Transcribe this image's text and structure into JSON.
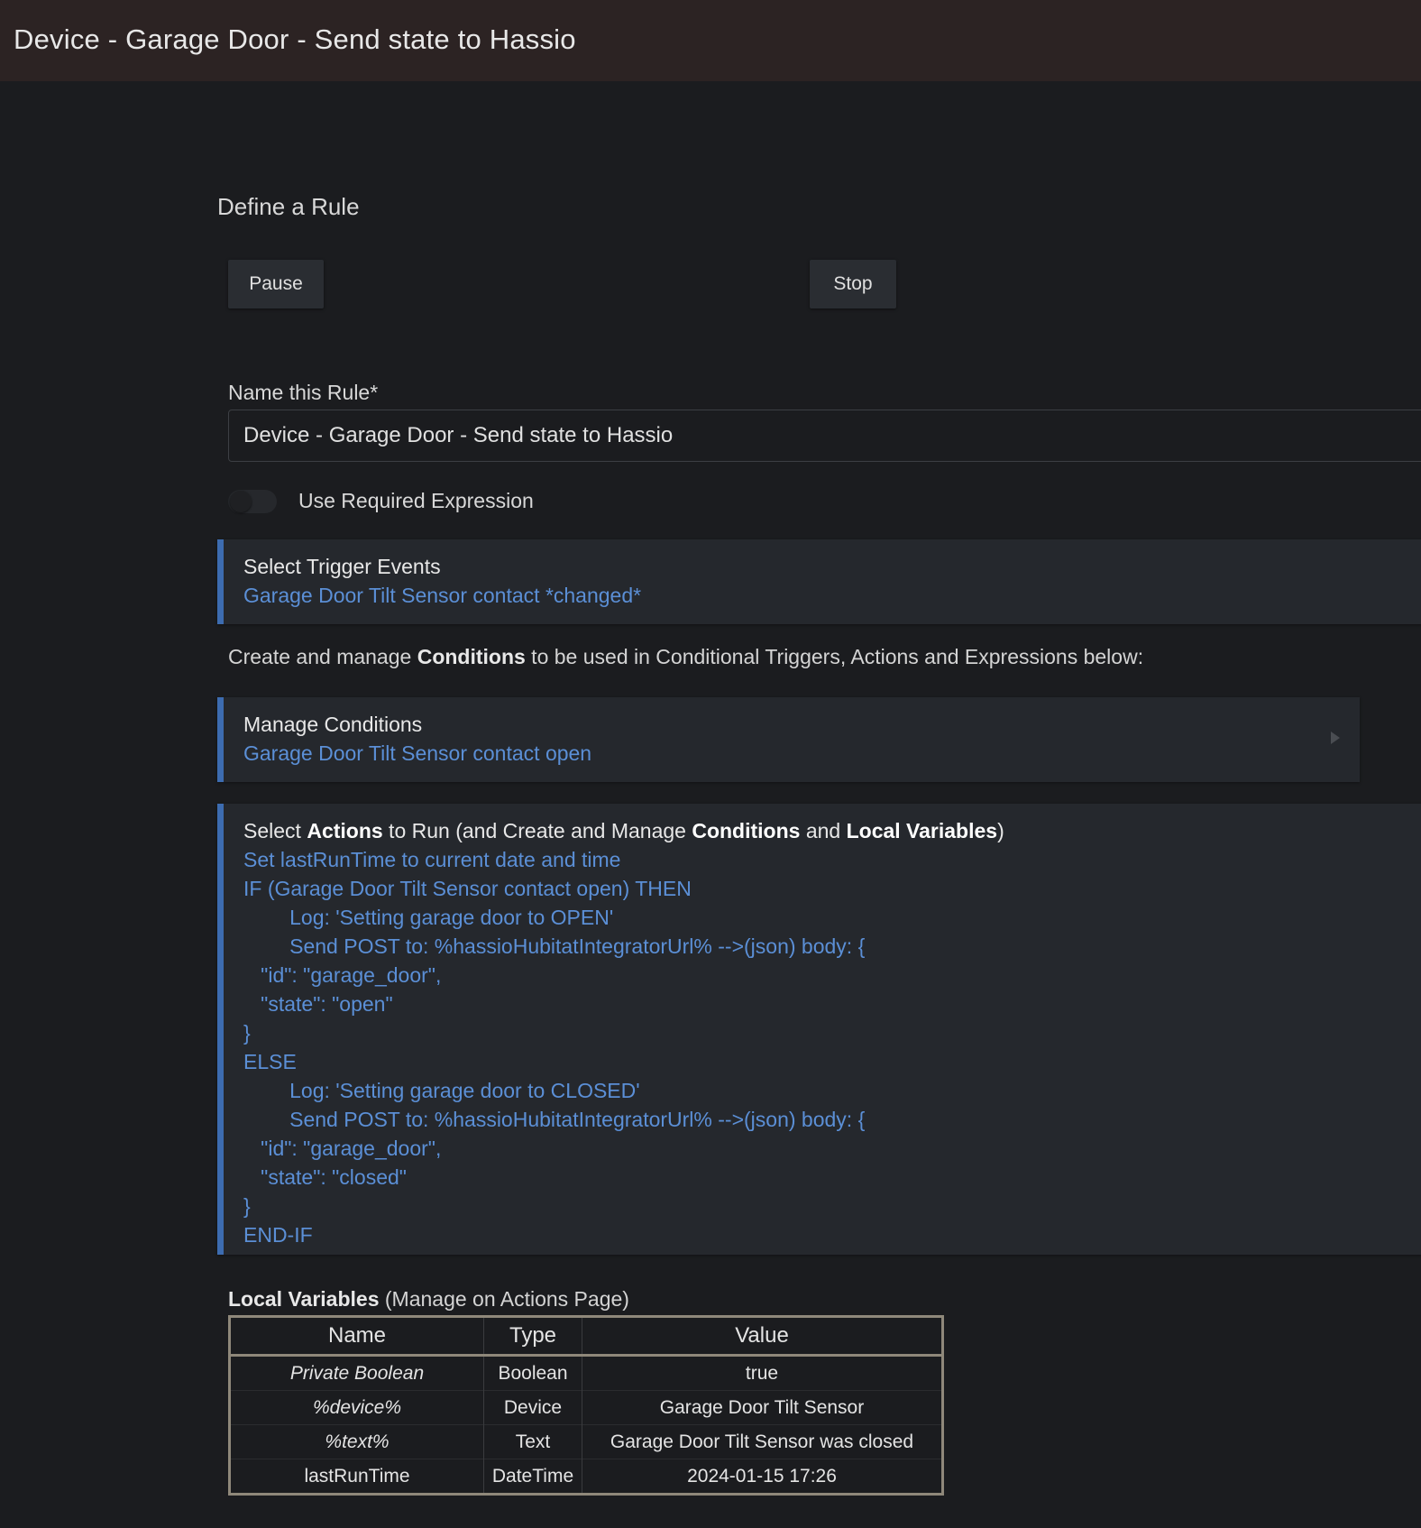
{
  "header": {
    "title": "Device - Garage Door - Send state to Hassio"
  },
  "section_title": "Define a Rule",
  "buttons": {
    "pause": "Pause",
    "stop": "Stop"
  },
  "name_field": {
    "label": "Name this Rule*",
    "value": "Device - Garage Door - Send state to Hassio"
  },
  "required_expression": {
    "label": "Use Required Expression",
    "enabled": false
  },
  "trigger_panel": {
    "title": "Select Trigger Events",
    "link": "Garage Door Tilt Sensor contact *changed*"
  },
  "conditions_intro": {
    "prefix": "Create and manage ",
    "bold": "Conditions",
    "suffix": " to be used in Conditional Triggers, Actions and Expressions below:"
  },
  "conditions_panel": {
    "title": "Manage Conditions",
    "link": "Garage Door Tilt Sensor contact open"
  },
  "actions_panel": {
    "title_parts": [
      "Select ",
      "Actions",
      " to Run (and Create and Manage ",
      "Conditions",
      " and ",
      "Local Variables",
      ")"
    ],
    "lines": [
      "Set lastRunTime to current date and time",
      "IF (Garage Door Tilt Sensor contact open) THEN",
      "        Log: 'Setting garage door to OPEN'",
      "        Send POST to: %hassioHubitatIntegratorUrl% -->(json) body: {",
      "   \"id\": \"garage_door\",",
      "   \"state\": \"open\"",
      "}",
      "ELSE",
      "        Log: 'Setting garage door to CLOSED'",
      "        Send POST to: %hassioHubitatIntegratorUrl% -->(json) body: {",
      "   \"id\": \"garage_door\",",
      "   \"state\": \"closed\"",
      "}",
      "END-IF"
    ]
  },
  "local_variables": {
    "title_bold": "Local Variables",
    "title_suffix": " (Manage on Actions Page)",
    "headers": [
      "Name",
      "Type",
      "Value"
    ],
    "rows": [
      {
        "name": "Private Boolean",
        "type": "Boolean",
        "value": "true",
        "italic": true
      },
      {
        "name": "%device%",
        "type": "Device",
        "value": "Garage Door Tilt Sensor",
        "italic": true
      },
      {
        "name": "%text%",
        "type": "Text",
        "value": "Garage Door Tilt Sensor was closed",
        "italic": true
      },
      {
        "name": "lastRunTime",
        "type": "DateTime",
        "value": "2024-01-15 17:26",
        "italic": false
      }
    ]
  }
}
